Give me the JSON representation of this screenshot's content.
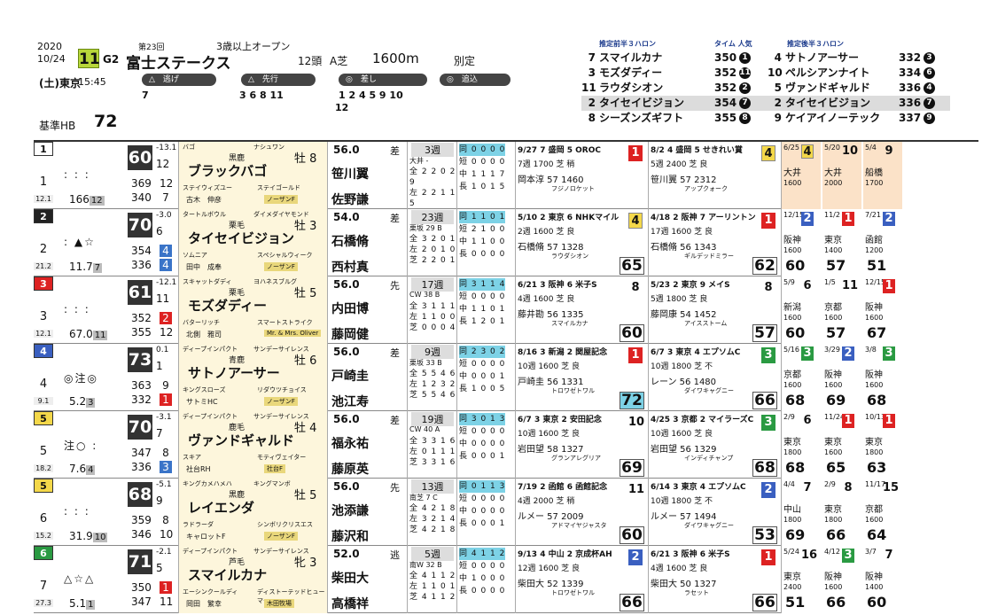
{
  "race": {
    "year": "2020",
    "date": "10/24",
    "race_number": "11",
    "grade": "G2",
    "kai": "第23回",
    "name": "富士ステークス",
    "condition": "3歳以上オープン",
    "fields": "12頭",
    "ashiba": "A芝",
    "distance": "1600m",
    "betsu": "別定",
    "day": "(土)",
    "venue": "東京",
    "post_time": "15:45",
    "kihon_label": "基準HB",
    "kihon_value": "72"
  },
  "styles": [
    {
      "label": "△　逃げ",
      "nums": "7"
    },
    {
      "label": "△　先行",
      "nums": "3 6 8 11"
    },
    {
      "label": "◎　差し",
      "nums": "1 2 4 5 9 10"
    },
    {
      "label": "◎　追込",
      "nums": "12"
    }
  ],
  "pred_first": {
    "title": "推定前半３ハロン",
    "time_label": "タイム 人気",
    "rows": [
      {
        "num": "7",
        "name": "スマイルカナ",
        "time": "350",
        "rank": "1",
        "hl": false
      },
      {
        "num": "3",
        "name": "モズダディー",
        "time": "352",
        "rank": "11",
        "hl": false
      },
      {
        "num": "11",
        "name": "ラウダシオン",
        "time": "352",
        "rank": "2",
        "hl": false
      },
      {
        "num": "2",
        "name": "タイセイビジョン",
        "time": "354",
        "rank": "7",
        "hl": true
      },
      {
        "num": "8",
        "name": "シーズンズギフト",
        "time": "355",
        "rank": "8",
        "hl": false
      }
    ]
  },
  "pred_last": {
    "title": "推定後半３ハロン",
    "rows": [
      {
        "num": "4",
        "name": "サトノアーサー",
        "time": "332",
        "rank": "3",
        "hl": false
      },
      {
        "num": "10",
        "name": "ペルシアンナイト",
        "time": "334",
        "rank": "6",
        "hl": false
      },
      {
        "num": "5",
        "name": "ヴァンドギャルド",
        "time": "336",
        "rank": "4",
        "hl": false
      },
      {
        "num": "2",
        "name": "タイセイビジョン",
        "time": "336",
        "rank": "7",
        "hl": true
      },
      {
        "num": "9",
        "name": "ケイアイノーテック",
        "time": "337",
        "rank": "9",
        "hl": false
      }
    ]
  },
  "colors": {
    "waku1": "#ffffff",
    "waku2": "#222222",
    "waku3": "#d22222",
    "waku4": "#3a5fc0",
    "waku5": "#f4d84a",
    "waku6": "#2a9a42"
  },
  "horses": [
    {
      "waku": "1",
      "umaban": "1",
      "odds": "12.1",
      "marks": ":  :  :",
      "odds_big": "166",
      "odds_rank": "12",
      "hb": "60",
      "hb_diff": "-13.1",
      "hb_sub": "12",
      "hb_v1": "369",
      "hb_r1": "12",
      "hb_v2": "340",
      "hb_r2": "7",
      "sire": "バゴ",
      "dam_sire_top": "ナシュワン",
      "stable": "黒鹿",
      "sex": "牡 8",
      "name": "ブラックバゴ",
      "dam": "ステイウィズユー",
      "bms": "ステイゴールド",
      "owner": "古木　伸彦",
      "breeder": "ノーザンF",
      "weight": "56.0",
      "style": "差",
      "jockey": "笹川翼",
      "trainer": "佐野謙",
      "weeks": "3週",
      "course": "大井 - ",
      "mini": [
        "全 2 2 0 2 9",
        "左 2 2 1 1 5",
        "芝 1 2 0 2 1"
      ],
      "recs": [
        "同 0 0 0 0",
        "短 0 0 0 0",
        "中 1 1 1 7",
        "長 1 0 1 5"
      ],
      "p1": {
        "date": "9/27",
        "race": "7 盛岡 5 OROC",
        "pos": "1",
        "pc": "r",
        "l2": "7週 1700 芝 稍",
        "l3": "岡本淳 57 1460",
        "l4": "フジノロケット",
        "rate": "",
        "rc": ""
      },
      "p2": {
        "date": "8/2",
        "race": "4 盛岡 5 せきれい賞",
        "pos": "4",
        "pc": "y",
        "l2": "5週 2400 芝 良",
        "l3": "笹川翼 57 2312",
        "l4": "アップクォーク",
        "rate": "",
        "rc": ""
      },
      "mc": [
        {
          "date": "6/25",
          "pos": "4",
          "pc": "y",
          "venue": "大井",
          "dist": "1600",
          "rate": ""
        },
        {
          "date": "5/20",
          "pos": "10",
          "pc": "w",
          "venue": "大井",
          "dist": "2000",
          "rate": ""
        },
        {
          "date": "5/4",
          "pos": "9",
          "pc": "w",
          "venue": "船橋",
          "dist": "1700",
          "rate": ""
        }
      ]
    },
    {
      "waku": "2",
      "umaban": "2",
      "odds": "21.2",
      "marks": ":  ▲☆",
      "odds_big": "11.7",
      "odds_rank": "7",
      "hb": "70",
      "hb_diff": "-3.0",
      "hb_sub": "6",
      "hb_v1": "354",
      "hb_r1": "4",
      "hb_v2": "336",
      "hb_r2": "4",
      "sire": "タートルボウル",
      "dam_sire_top": "ダイメダイヤモンド",
      "stable": "栗毛",
      "sex": "牡 3",
      "name": "タイセイビジョン",
      "dam": "ソムニア",
      "bms": "スペシャルウィーク",
      "owner": "田中　成奉",
      "breeder": "ノーザンF",
      "weight": "54.0",
      "style": "差",
      "jockey": "石橋脩",
      "trainer": "西村真",
      "weeks": "23週",
      "course": "栗坂 29 B",
      "mini": [
        "全 3 2 0 1",
        "左 2 0 1 0",
        "芝 2 2 0 1"
      ],
      "recs": [
        "同 1 1 0 1",
        "短 2 1 0 0",
        "中 1 1 0 0",
        "長 0 0 0 0"
      ],
      "p1": {
        "date": "5/10",
        "race": "2 東京 6 NHKマイル",
        "pos": "4",
        "pc": "y",
        "l2": "2週 1600 芝 良",
        "l3": "石橋脩 57 1328",
        "l4": "ラウダシオン",
        "rate": "65",
        "rc": ""
      },
      "p2": {
        "date": "4/18",
        "race": "2 阪神 7 アーリントン",
        "pos": "1",
        "pc": "r",
        "l2": "17週 1600 芝 良",
        "l3": "石橋脩 56 1343",
        "l4": "ギルデッドミラー",
        "rate": "62",
        "rc": ""
      },
      "mc": [
        {
          "date": "12/15",
          "pos": "2",
          "pc": "b",
          "venue": "阪神",
          "dist": "1600",
          "rate": "60"
        },
        {
          "date": "11/2",
          "pos": "1",
          "pc": "r",
          "venue": "東京",
          "dist": "1400",
          "rate": "57"
        },
        {
          "date": "7/21",
          "pos": "2",
          "pc": "b",
          "venue": "函館",
          "dist": "1200",
          "rate": "51"
        }
      ]
    },
    {
      "waku": "3",
      "umaban": "3",
      "odds": "12.1",
      "marks": ":  :  :",
      "odds_big": "67.0",
      "odds_rank": "11",
      "hb": "61",
      "hb_diff": "-12.1",
      "hb_sub": "11",
      "hb_v1": "352",
      "hb_r1": "2",
      "hb_v2": "355",
      "hb_r2": "12",
      "sire": "スキャットダディ",
      "dam_sire_top": "ヨハネスブルグ",
      "stable": "栗毛",
      "sex": "牡 5",
      "name": "モズダディー",
      "dam": "バターリッチ",
      "bms": "スマートストライク",
      "owner": "北側　雅司",
      "breeder": "Mr. & Mrs. Oliver",
      "weight": "56.0",
      "style": "先",
      "jockey": "内田博",
      "trainer": "藤岡健",
      "weeks": "17週",
      "course": "CW 38 B",
      "mini": [
        "全 3 1 1 1",
        "左 1 1 0 0",
        "芝 0 0 0 4"
      ],
      "recs": [
        "同 3 1 1 4",
        "短 0 0 0 0",
        "中 1 1 0 1",
        "長 1 2 0 1"
      ],
      "p1": {
        "date": "6/21",
        "race": "3 阪神 6 米子S",
        "pos": "8",
        "pc": "w",
        "l2": "4週 1600 芝 良",
        "l3": "藤井勘 56 1335",
        "l4": "スマイルカナ",
        "rate": "60",
        "rc": ""
      },
      "p2": {
        "date": "5/23",
        "race": "2 東京 9 メイS",
        "pos": "8",
        "pc": "w",
        "l2": "5週 1800 芝 良",
        "l3": "藤岡康 54 1452",
        "l4": "アイスストーム",
        "rate": "57",
        "rc": ""
      },
      "mc": [
        {
          "date": "5/9",
          "pos": "6",
          "pc": "w",
          "venue": "新潟",
          "dist": "1600",
          "rate": "60"
        },
        {
          "date": "1/5",
          "pos": "11",
          "pc": "w",
          "venue": "京都",
          "dist": "1600",
          "rate": "57"
        },
        {
          "date": "12/15",
          "pos": "1",
          "pc": "r",
          "venue": "阪神",
          "dist": "1600",
          "rate": "67"
        }
      ]
    },
    {
      "waku": "4",
      "umaban": "4",
      "odds": "9.1",
      "marks": "◎注◎",
      "odds_big": "5.2",
      "odds_rank": "3",
      "hb": "73",
      "hb_diff": "0.1",
      "hb_sub": "1",
      "hb_v1": "363",
      "hb_r1": "9",
      "hb_v2": "332",
      "hb_r2": "1",
      "sire": "ディープインパクト",
      "dam_sire_top": "サンデーサイレンス",
      "stable": "青鹿",
      "sex": "牡 6",
      "name": "サトノアーサー",
      "dam": "キングスローズ",
      "bms": "リダウツチョイス",
      "owner": "サトミHC",
      "breeder": "ノーザンF",
      "weight": "56.0",
      "style": "差",
      "jockey": "戸崎圭",
      "trainer": "池江寿",
      "weeks": "9週",
      "course": "栗坂 33 B",
      "mini": [
        "全 5 5 4 6",
        "左 1 2 3 2",
        "芝 5 5 4 6"
      ],
      "recs": [
        "同 2 3 0 2",
        "短 0 0 0 0",
        "中 0 0 0 1",
        "長 1 0 0 5"
      ],
      "p1": {
        "date": "8/16",
        "race": "3 新潟 2 関屋記念",
        "pos": "1",
        "pc": "r",
        "l2": "10週 1600 芝 良",
        "l3": "戸崎圭 56 1331",
        "l4": "トロワゼトワル",
        "rate": "72",
        "rc": "c"
      },
      "p2": {
        "date": "6/7",
        "race": "3 東京 4 エプソムC",
        "pos": "3",
        "pc": "g",
        "l2": "10週 1800 芝 不",
        "l3": "レーン 56 1480",
        "l4": "ダイワキャグニー",
        "rate": "66",
        "rc": ""
      },
      "mc": [
        {
          "date": "5/16",
          "pos": "3",
          "pc": "g",
          "venue": "京都",
          "dist": "1600",
          "rate": "68"
        },
        {
          "date": "3/29",
          "pos": "2",
          "pc": "b",
          "venue": "阪神",
          "dist": "1600",
          "rate": "69"
        },
        {
          "date": "3/8",
          "pos": "3",
          "pc": "g",
          "venue": "阪神",
          "dist": "1600",
          "rate": "68"
        }
      ]
    },
    {
      "waku": "5",
      "umaban": "5",
      "odds": "18.2",
      "marks": "注○  :",
      "odds_big": "7.6",
      "odds_rank": "4",
      "hb": "70",
      "hb_diff": "-3.1",
      "hb_sub": "7",
      "hb_v1": "347",
      "hb_r1": "8",
      "hb_v2": "336",
      "hb_r2": "3",
      "sire": "ディープインパクト",
      "dam_sire_top": "サンデーサイレンス",
      "stable": "鹿毛",
      "sex": "牡 4",
      "name": "ヴァンドギャルド",
      "dam": "スキア",
      "bms": "モティヴェイター",
      "owner": "社台RH",
      "breeder": "社台F",
      "weight": "56.0",
      "style": "差",
      "jockey": "福永祐",
      "trainer": "藤原英",
      "weeks": "19週",
      "course": "CW 40 A",
      "mini": [
        "全 3 3 1 6",
        "左 0 1 1 1",
        "芝 3 3 1 6"
      ],
      "recs": [
        "同 3 0 1 3",
        "短 0 0 0 0",
        "中 0 0 0 0",
        "長 0 0 0 1"
      ],
      "p1": {
        "date": "6/7",
        "race": "3 東京 2 安田記念",
        "pos": "10",
        "pc": "w",
        "l2": "10週 1600 芝 良",
        "l3": "岩田望 58 1327",
        "l4": "グランアレグリア",
        "rate": "69",
        "rc": ""
      },
      "p2": {
        "date": "4/25",
        "race": "3 京都 2 マイラーズC",
        "pos": "3",
        "pc": "g",
        "l2": "10週 1600 芝 良",
        "l3": "岩田望 56 1329",
        "l4": "インディチャンプ",
        "rate": "68",
        "rc": ""
      },
      "mc": [
        {
          "date": "2/9",
          "pos": "6",
          "pc": "w",
          "venue": "東京",
          "dist": "1800",
          "rate": "68"
        },
        {
          "date": "11/24",
          "pos": "1",
          "pc": "r",
          "venue": "東京",
          "dist": "1600",
          "rate": "65"
        },
        {
          "date": "10/13",
          "pos": "1",
          "pc": "r",
          "venue": "東京",
          "dist": "1800",
          "rate": "63"
        }
      ]
    },
    {
      "waku": "5",
      "umaban": "6",
      "odds": "15.2",
      "marks": ":  :  :",
      "odds_big": "31.9",
      "odds_rank": "10",
      "hb": "68",
      "hb_diff": "-5.1",
      "hb_sub": "9",
      "hb_v1": "359",
      "hb_r1": "8",
      "hb_v2": "346",
      "hb_r2": "10",
      "sire": "キングカメハメハ",
      "dam_sire_top": "キングマンボ",
      "stable": "黒鹿",
      "sex": "牡 5",
      "name": "レイエンダ",
      "dam": "ラドラーダ",
      "bms": "シンボリクリスエス",
      "owner": "キャロットF",
      "breeder": "ノーザンF",
      "weight": "56.0",
      "style": "先",
      "jockey": "池添謙",
      "trainer": "藤沢和",
      "weeks": "13週",
      "course": "南芝 7 C",
      "mini": [
        "全 4 2 1 8",
        "左 3 2 1 4",
        "芝 4 2 1 8"
      ],
      "recs": [
        "同 0 1 1 3",
        "短 0 0 0 0",
        "中 0 0 0 0",
        "長 0 0 0 1"
      ],
      "p1": {
        "date": "7/19",
        "race": "2 函館 6 函館記念",
        "pos": "11",
        "pc": "w",
        "l2": "4週 2000 芝 稍",
        "l3": "ルメー 57 2009",
        "l4": "アドマイヤジャスタ",
        "rate": "60",
        "rc": ""
      },
      "p2": {
        "date": "6/14",
        "race": "3 東京 4 エプソムC",
        "pos": "2",
        "pc": "b",
        "l2": "10週 1800 芝 不",
        "l3": "ルメー 57 1494",
        "l4": "ダイワキャグニー",
        "rate": "53",
        "rc": ""
      },
      "mc": [
        {
          "date": "4/4",
          "pos": "7",
          "pc": "w",
          "venue": "中山",
          "dist": "1800",
          "rate": "69"
        },
        {
          "date": "2/9",
          "pos": "8",
          "pc": "w",
          "venue": "東京",
          "dist": "1800",
          "rate": "66"
        },
        {
          "date": "11/17",
          "pos": "15",
          "pc": "w",
          "venue": "京都",
          "dist": "1600",
          "rate": "64"
        }
      ]
    },
    {
      "waku": "6",
      "umaban": "7",
      "odds": "27.3",
      "marks": "△☆△",
      "odds_big": "5.1",
      "odds_rank": "1",
      "hb": "71",
      "hb_diff": "-2.1",
      "hb_sub": "5",
      "hb_v1": "350",
      "hb_r1": "1",
      "hb_v2": "347",
      "hb_r2": "11",
      "sire": "ディープインパクト",
      "dam_sire_top": "サンデーサイレンス",
      "stable": "芦毛",
      "sex": "牝 3",
      "name": "スマイルカナ",
      "dam": "エーシンクールディ",
      "bms": "ディストーテッドヒューマー",
      "owner": "岡田　繁幸",
      "breeder": "木田牧場",
      "weight": "52.0",
      "style": "逃",
      "jockey": "柴田大",
      "trainer": "高橋祥",
      "weeks": "5週",
      "course": "南W 32 B",
      "mini": [
        "全 4 1 1 2",
        "左 1 1 0 1",
        "芝 4 1 1 2"
      ],
      "recs": [
        "同 4 1 1 2",
        "短 0 0 0 0",
        "中 1 0 0 0",
        "長 0 0 0 0"
      ],
      "p1": {
        "date": "9/13",
        "race": "4 中山 2 京成杯AH",
        "pos": "2",
        "pc": "b",
        "l2": "12週 1600 芝 良",
        "l3": "柴田大 52 1339",
        "l4": "トロワゼトワル",
        "rate": "66",
        "rc": ""
      },
      "p2": {
        "date": "6/21",
        "race": "3 阪神 6 米子S",
        "pos": "1",
        "pc": "r",
        "l2": "4週 1600 芝 良",
        "l3": "柴田大 50 1327",
        "l4": "ラセット",
        "rate": "66",
        "rc": ""
      },
      "mc": [
        {
          "date": "5/24",
          "pos": "16",
          "pc": "w",
          "venue": "東京",
          "dist": "2400",
          "rate": "51"
        },
        {
          "date": "4/12",
          "pos": "3",
          "pc": "g",
          "venue": "阪神",
          "dist": "1600",
          "rate": "66"
        },
        {
          "date": "3/7",
          "pos": "7",
          "pc": "w",
          "venue": "阪神",
          "dist": "1400",
          "rate": "60"
        }
      ]
    }
  ]
}
